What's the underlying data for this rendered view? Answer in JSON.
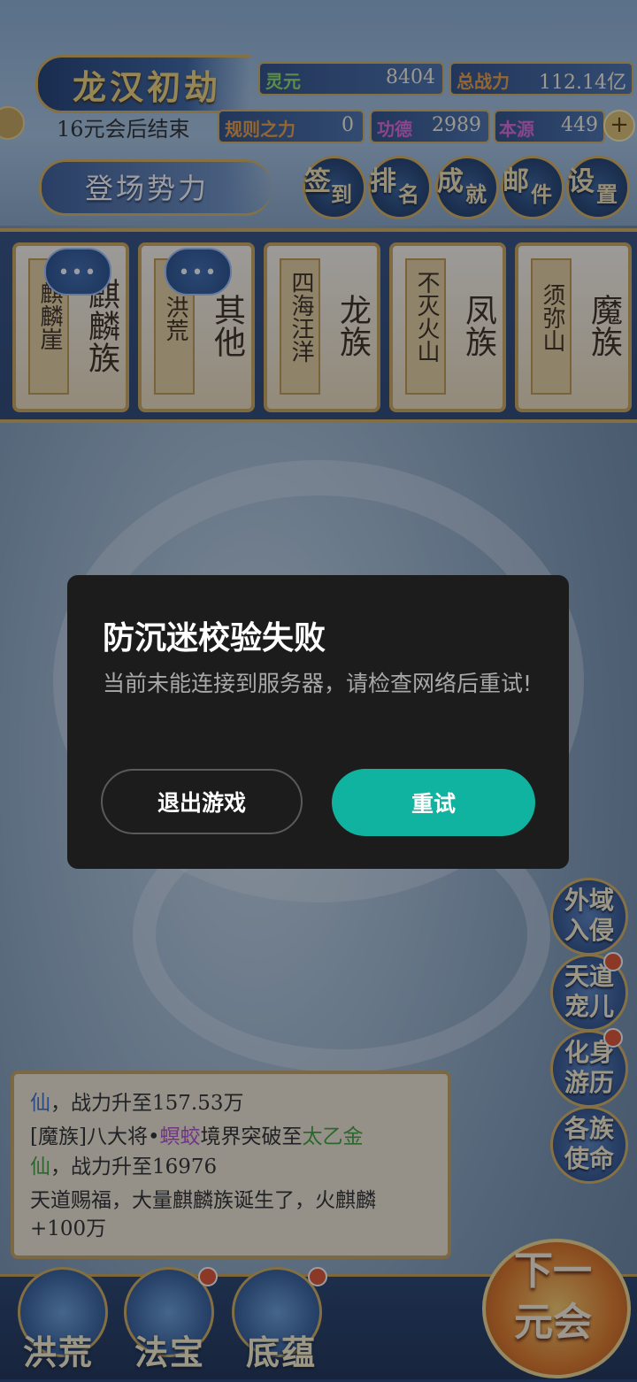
{
  "header": {
    "title": "龙汉初劫",
    "subtitle": "16元会后结束",
    "power_label": "登场势力",
    "stats": {
      "lingyuan_label": "灵元",
      "lingyuan_value": "8404",
      "total_power_label": "总战力",
      "total_power_value": "112.14亿",
      "rule_label": "规则之力",
      "rule_value": "0",
      "merit_label": "功德",
      "merit_value": "2989",
      "origin_label": "本源",
      "origin_value": "449"
    },
    "plus_symbol": "+",
    "menu": [
      {
        "c1": "签",
        "c2": "到"
      },
      {
        "c1": "排",
        "c2": "名"
      },
      {
        "c1": "成",
        "c2": "就"
      },
      {
        "c1": "邮",
        "c2": "件"
      },
      {
        "c1": "设",
        "c2": "置"
      }
    ]
  },
  "factions": [
    {
      "location": "麒麟崖",
      "name": "麒麟族"
    },
    {
      "location": "洪荒",
      "name": "其他"
    },
    {
      "location": "四海汪洋",
      "name": "龙族"
    },
    {
      "location": "不灭火山",
      "name": "凤族"
    },
    {
      "location": "须弥山",
      "name": "魔族"
    }
  ],
  "chat_dots": "•••",
  "side_buttons": [
    {
      "label": "外域入侵",
      "has_dot": false
    },
    {
      "label": "天道宠儿",
      "has_dot": true
    },
    {
      "label": "化身游历",
      "has_dot": true
    },
    {
      "label": "各族使命",
      "has_dot": false
    }
  ],
  "news": {
    "line1_a": "仙",
    "line1_b": "，战力升至157.53万",
    "line2_a": "[魔族]八大将•",
    "line2_b": "螟蛟",
    "line2_c": "境界突破至",
    "line2_d": "太乙金",
    "line3_a": "仙",
    "line3_b": "，战力升至16976",
    "line4": "天道赐福，大量麒麟族诞生了，火麒麟",
    "line5": "+100万"
  },
  "bottom_nav": [
    {
      "label": "洪荒",
      "has_dot": false
    },
    {
      "label": "法宝",
      "has_dot": true
    },
    {
      "label": "底蕴",
      "has_dot": true
    }
  ],
  "next_button": {
    "line1": "下一",
    "line2": "元会"
  },
  "modal": {
    "title": "防沉迷校验失败",
    "message": "当前未能连接到服务器，请检查网络后重试!",
    "exit_label": "退出游戏",
    "retry_label": "重试"
  },
  "colors": {
    "retry_accent": "#10b3a0",
    "modal_bg": "#1c1c1c"
  }
}
